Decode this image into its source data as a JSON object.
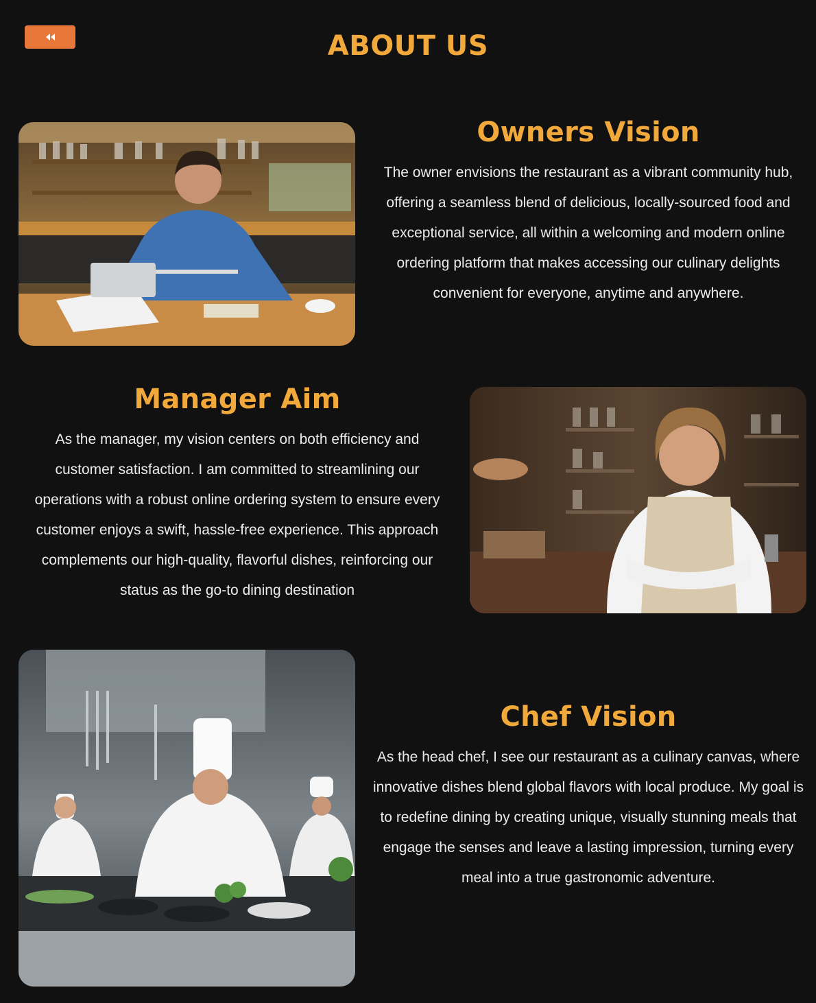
{
  "header": {
    "back_icon": "double-chevron-left-icon",
    "title": "ABOUT US"
  },
  "colors": {
    "background": "#111111",
    "accent": "#f2a93b",
    "back_button": "#e8773a",
    "body_text": "#ececec"
  },
  "sections": [
    {
      "heading": "Owners Vision",
      "body": "The owner envisions the restaurant as a vibrant community hub, offering a seamless blend of delicious, locally-sourced food and exceptional service, all within a welcoming and modern online ordering platform that makes accessing our culinary delights convenient for everyone, anytime and anywhere.",
      "image": "owner-photo"
    },
    {
      "heading": "Manager Aim",
      "body": "As the manager, my vision centers on both efficiency and customer satisfaction. I am committed to streamlining our operations with a robust online ordering system to ensure every customer enjoys a swift, hassle-free experience. This approach complements our high-quality, flavorful dishes, reinforcing our status as the go-to dining destination",
      "image": "manager-photo"
    },
    {
      "heading": "Chef Vision",
      "body": "As the head chef, I see our restaurant as a culinary canvas, where innovative dishes blend global flavors with local produce. My goal is to redefine dining by creating unique, visually stunning meals that engage the senses and leave a lasting impression, turning every meal into a true gastronomic adventure.",
      "image": "chef-photo"
    }
  ]
}
